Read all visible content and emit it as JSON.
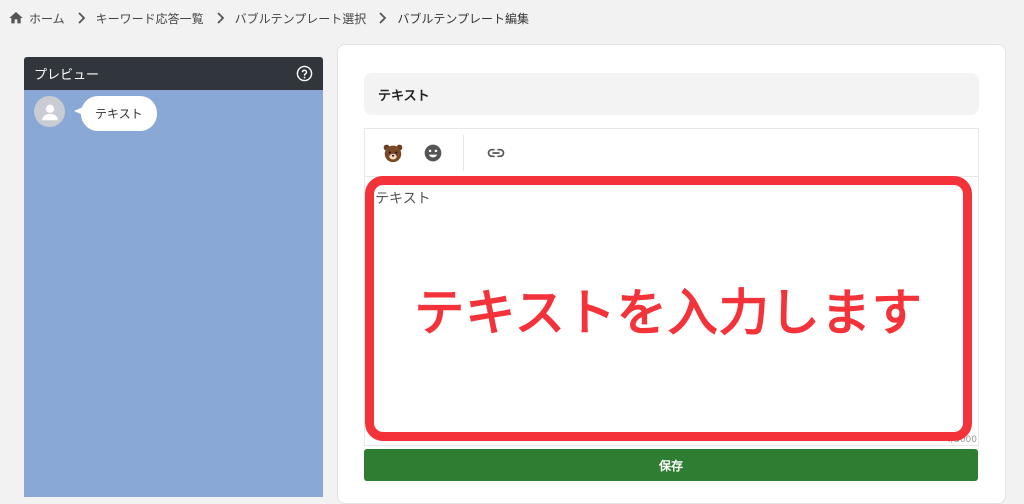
{
  "breadcrumb": {
    "items": [
      {
        "label": "ホーム",
        "icon": "home-icon"
      },
      {
        "label": "キーワード応答一覧"
      },
      {
        "label": "バブルテンプレート選択"
      },
      {
        "label": "バブルテンプレート編集"
      }
    ]
  },
  "preview": {
    "title": "プレビュー",
    "help_icon": "help-circle-icon",
    "message_text": "テキスト",
    "background_color": "#8aa8d6"
  },
  "editor": {
    "section_title": "テキスト",
    "toolbar": [
      {
        "icon": "bear-emoji-icon"
      },
      {
        "icon": "smiley-icon"
      },
      {
        "icon": "link-icon"
      }
    ],
    "value": "テキスト",
    "char_count": "4/5000"
  },
  "annotation": {
    "text": "テキストを入力します",
    "color": "#f3323a"
  },
  "save_button": {
    "label": "保存",
    "color": "#2e7d32"
  }
}
